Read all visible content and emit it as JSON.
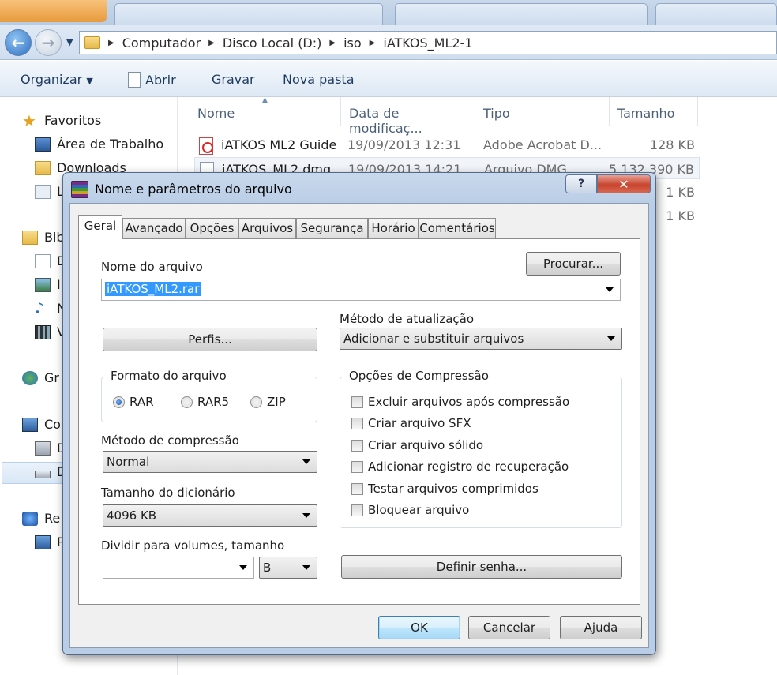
{
  "explorer": {
    "address_crumbs": [
      "Computador",
      "Disco Local (D:)",
      "iso",
      "iATKOS_ML2-1"
    ],
    "commands": {
      "organize": "Organizar",
      "open": "Abrir",
      "burn": "Gravar",
      "new_folder": "Nova pasta"
    },
    "nav": {
      "favorites": "Favoritos",
      "desktop": "Área de Trabalho",
      "downloads": "Downloads",
      "recent": "L",
      "libraries": "Bib",
      "lib_docs": "D",
      "lib_images": "I",
      "lib_music": "N",
      "lib_videos": "V",
      "homegroup": "Gr",
      "computer": "Co",
      "drive_c": "D",
      "drive_d": "D",
      "network": "Re",
      "network_pc": "P"
    },
    "columns": {
      "name": "Nome",
      "modified": "Data de modificaç...",
      "type": "Tipo",
      "size": "Tamanho"
    },
    "files": [
      {
        "name": "iATKOS ML2 Guide",
        "modified": "19/09/2013 12:31",
        "type": "Adobe Acrobat D...",
        "size": "128 KB"
      },
      {
        "name": "iATKOS_ML2.dmg",
        "modified": "19/09/2013 14:21",
        "type": "Arquivo DMG",
        "size": "5.132.390 KB"
      },
      {
        "size": "1 KB"
      },
      {
        "size": "1 KB"
      }
    ]
  },
  "dialog": {
    "title": "Nome e parâmetros do arquivo",
    "help_glyph": "?",
    "close_glyph": "✕",
    "tabs": [
      "Geral",
      "Avançado",
      "Opções",
      "Arquivos",
      "Segurança",
      "Horário",
      "Comentários"
    ],
    "filename_label": "Nome do arquivo",
    "browse_button": "Procurar...",
    "filename_value": "iATKOS_ML2.rar",
    "profiles_button": "Perfis...",
    "update_method_label": "Método de atualização",
    "update_method_value": "Adicionar e substituir arquivos",
    "format_group": "Formato do arquivo",
    "formats": [
      "RAR",
      "RAR5",
      "ZIP"
    ],
    "selected_format": "RAR",
    "compression_method_label": "Método de compressão",
    "compression_method_value": "Normal",
    "dictionary_label": "Tamanho do dicionário",
    "dictionary_value": "4096 KB",
    "split_label": "Dividir para volumes, tamanho",
    "split_value": "",
    "split_unit": "B",
    "options_group": "Opções de Compressão",
    "options": [
      "Excluir arquivos após compressão",
      "Criar arquivo SFX",
      "Criar arquivo sólido",
      "Adicionar registro de recuperação",
      "Testar arquivos comprimidos",
      "Bloquear arquivo"
    ],
    "password_button": "Definir senha...",
    "ok": "OK",
    "cancel": "Cancelar",
    "help": "Ajuda"
  }
}
